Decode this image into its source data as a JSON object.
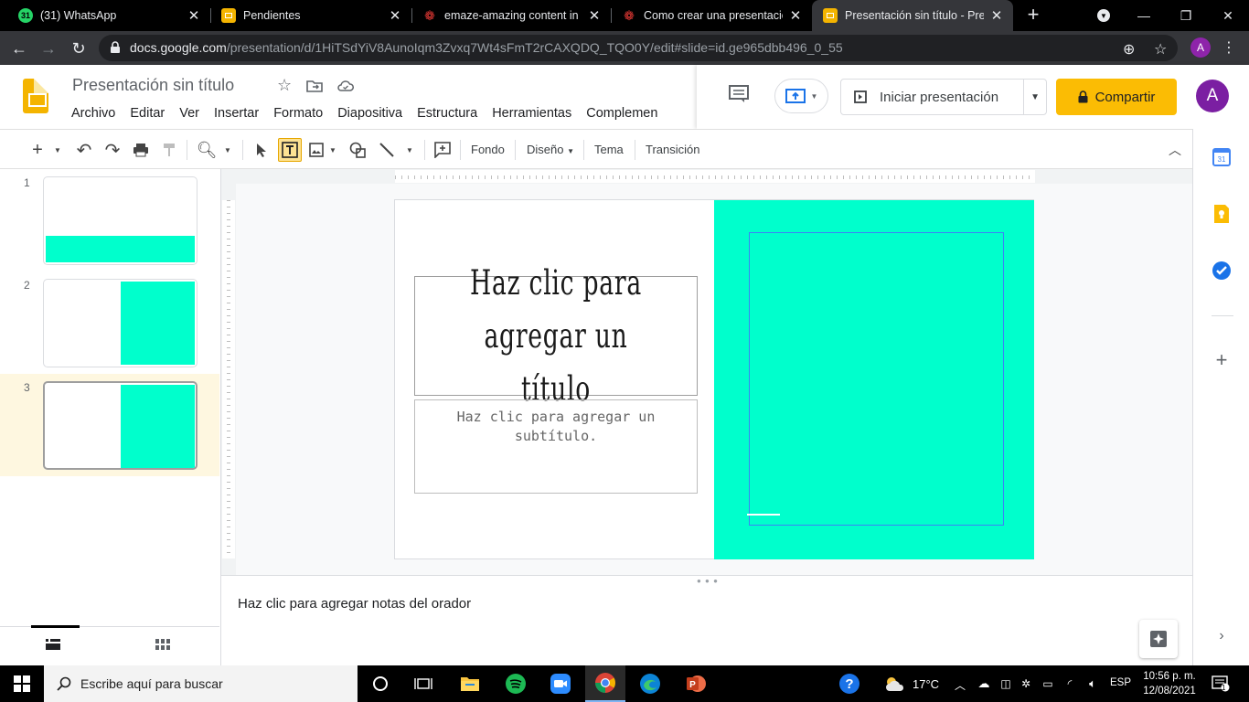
{
  "browser": {
    "tabs": [
      {
        "title": "(31) WhatsApp",
        "badge": "31",
        "favicon_color": "#25d366",
        "favicon_name": "whatsapp-icon"
      },
      {
        "title": "Pendientes",
        "favicon_color": "#f4b400",
        "favicon_name": "slides-icon"
      },
      {
        "title": "emaze-amazing content in m",
        "favicon_color": "#c62828",
        "favicon_name": "emaze-icon"
      },
      {
        "title": "Como crear una presentacion",
        "favicon_color": "#c62828",
        "favicon_name": "emaze-icon"
      },
      {
        "title": "Presentación sin título - Prese",
        "favicon_color": "#f4b400",
        "favicon_name": "slides-icon",
        "active": true
      }
    ],
    "url_domain": "docs.google.com",
    "url_path": "/presentation/d/1HiTSdYiV8AunoIqm3Zvxq7Wt4sFmT2rCAXQDQ_TQO0Y/edit#slide=id.ge965dbb496_0_55",
    "profile_initial": "A"
  },
  "app": {
    "doc_title": "Presentación sin título",
    "menu": [
      "Archivo",
      "Editar",
      "Ver",
      "Insertar",
      "Formato",
      "Diapositiva",
      "Estructura",
      "Herramientas",
      "Complemen"
    ],
    "present_label": "Iniciar presentación",
    "share_label": "Compartir",
    "user_initial": "A",
    "accent_share": "#fbbc04",
    "avatar_color": "#7b1fa2"
  },
  "toolbar": {
    "fondo": "Fondo",
    "diseno": "Diseño",
    "tema": "Tema",
    "transicion": "Transición"
  },
  "filmstrip": {
    "slides": [
      {
        "number": "1",
        "layout": "bottom-band"
      },
      {
        "number": "2",
        "layout": "right-panel"
      },
      {
        "number": "3",
        "layout": "right-panel",
        "selected": true
      }
    ]
  },
  "slide": {
    "title_placeholder": "Haz clic para agregar un título",
    "subtitle_placeholder": "Haz clic para agregar un subtítulo.",
    "accent_color": "#00ffcc"
  },
  "notes": {
    "placeholder": "Haz clic para agregar notas del orador"
  },
  "taskbar": {
    "search_placeholder": "Escribe aquí para buscar",
    "temperature": "17°C",
    "language": "ESP",
    "time": "10:56 p. m.",
    "date": "12/08/2021",
    "notification_count": "1",
    "apps": [
      "task-view",
      "file-explorer",
      "spotify",
      "zoom",
      "chrome",
      "edge",
      "powerpoint"
    ]
  }
}
